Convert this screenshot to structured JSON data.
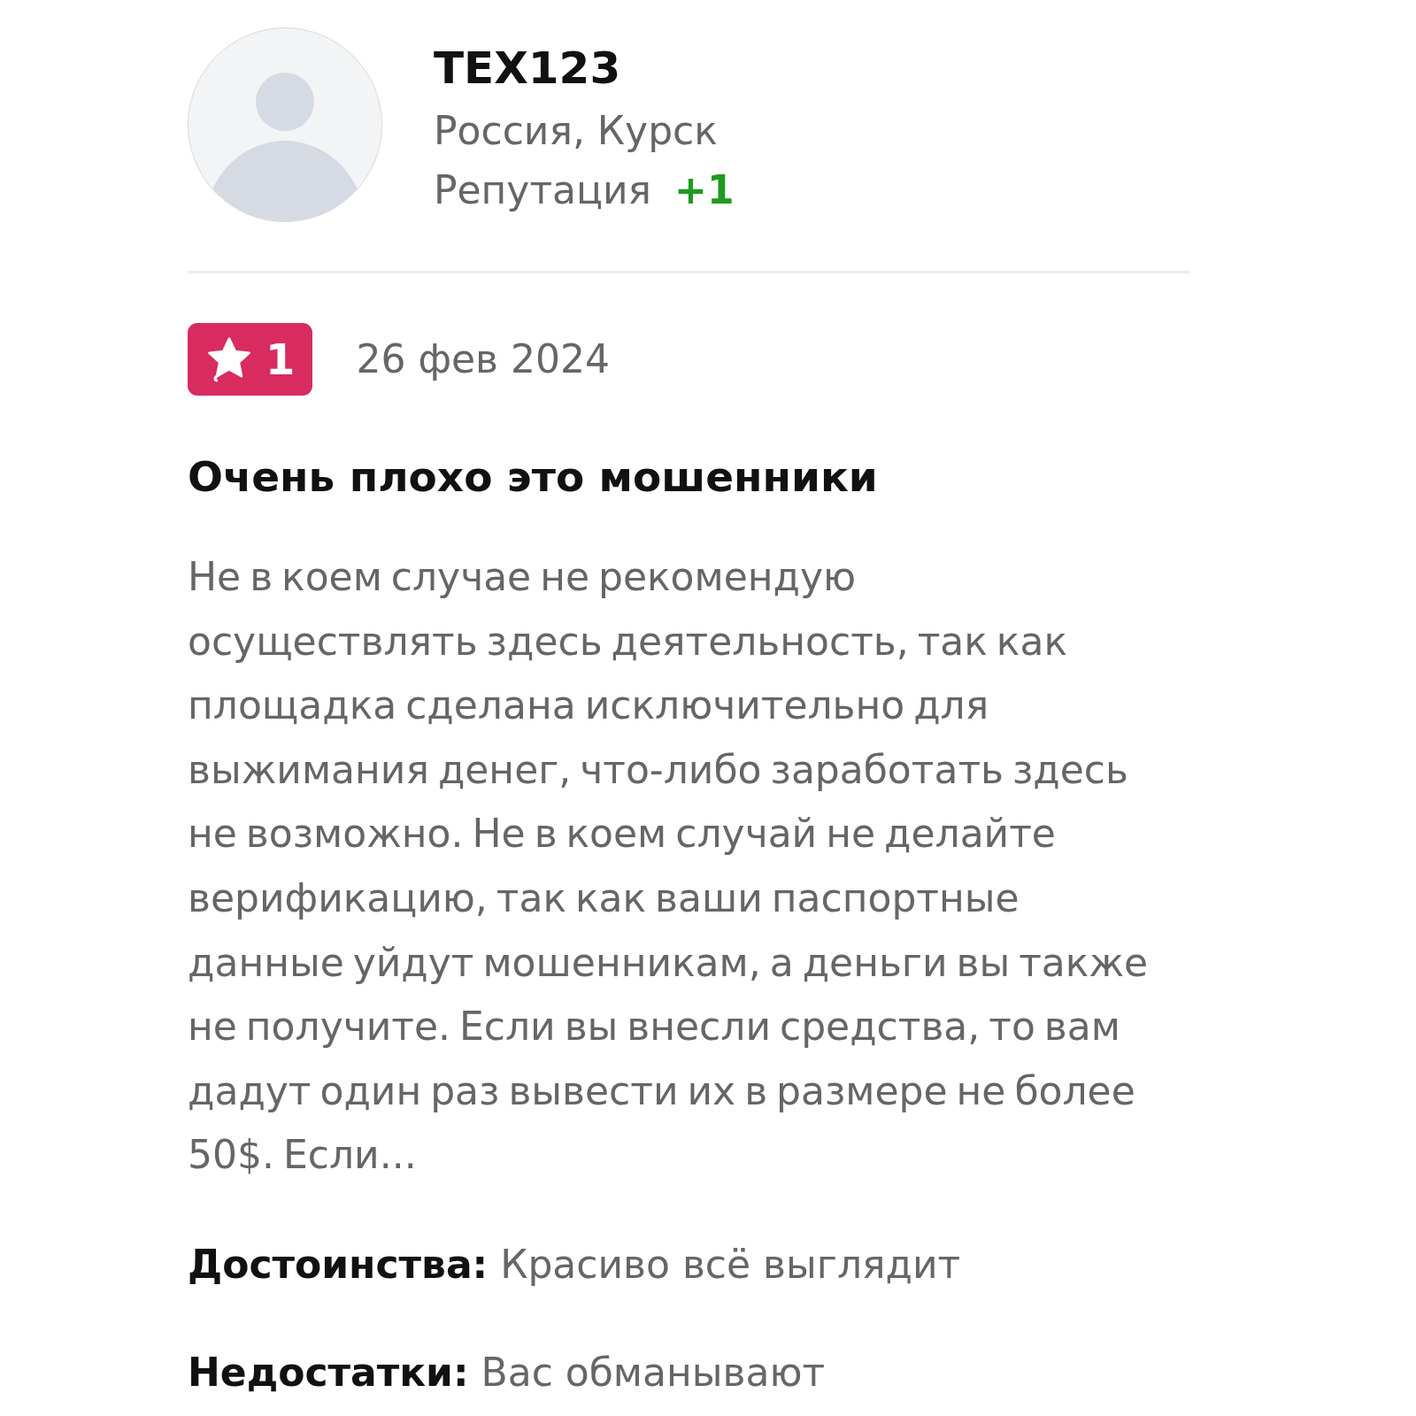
{
  "profile": {
    "name": "TEX123",
    "location": "Россия, Курск",
    "reputation": {
      "label": "Репутация",
      "value": "+1"
    }
  },
  "review": {
    "rating": "1",
    "date": "26 фев 2024",
    "title": "Очень плохо это мошенники",
    "text": "Не в коем случае не рекомендую осуществлять здесь деятельность, так как площадка сделана исключительно для выжимания денег, что-либо заработать здесь не возможно. Не в коем случай не делайте верификацию, так как ваши паспортные данные уйдут мошенникам, а деньги вы также не получите. Если вы внесли средства, то вам дадут один раз вывести их в размере не более 50$. Если...",
    "details": [
      "**Достоинства:** Красиво всё выглядит",
      "**Недостатки:** Вас обманывают"
    ]
  }
}
